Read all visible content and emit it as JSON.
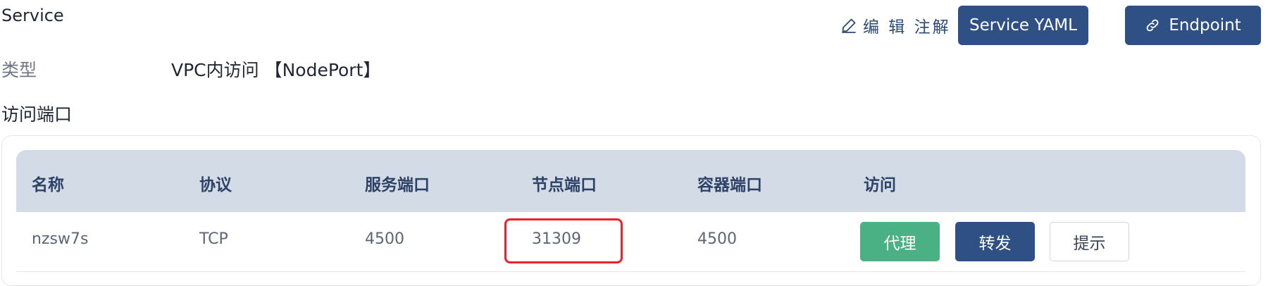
{
  "section": {
    "title": "Service"
  },
  "actions": {
    "annotate_label": "编 辑 注解",
    "yaml_label": "Service YAML",
    "endpoint_label": "Endpoint"
  },
  "info": {
    "type_label": "类型",
    "type_value": "VPC内访问 【NodePort】"
  },
  "ports": {
    "heading": "访问端口",
    "columns": [
      "名称",
      "协议",
      "服务端口",
      "节点端口",
      "容器端口",
      "访问"
    ],
    "rows": [
      {
        "name": "nzsw7s",
        "protocol": "TCP",
        "service_port": "4500",
        "node_port": "31309",
        "container_port": "4500",
        "access_buttons": [
          "代理",
          "转发",
          "提示"
        ]
      }
    ],
    "highlighted_cell": "node_port"
  },
  "icons": {
    "annotate": "edit-icon",
    "endpoint": "link-icon"
  },
  "colors": {
    "primary": "#2f5084",
    "success": "#49b183",
    "header_bg": "#d3dbe7",
    "highlight": "#e8232d"
  }
}
